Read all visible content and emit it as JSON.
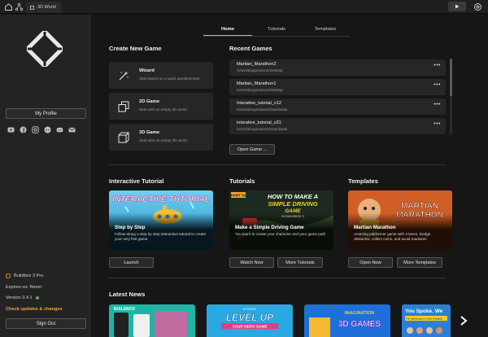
{
  "topbar": {
    "tab_title": "3D World"
  },
  "sidebar": {
    "profile_label": "My Profile",
    "socials": [
      "youtube-icon",
      "facebook-icon",
      "instagram-icon",
      "reddit-icon",
      "discord-icon",
      "mail-icon"
    ],
    "product": "Buildbox 3 Pro",
    "expires": "Expires on: Never",
    "version": "Version 3.4.1",
    "check_updates": "Check updates & changes",
    "signout_label": "Sign Out",
    "status_color": "#4caf50"
  },
  "nav": {
    "tabs": [
      "Home",
      "Tutorials",
      "Templates"
    ],
    "active": 0
  },
  "create": {
    "heading": "Create New Game",
    "items": [
      {
        "title": "Wizard",
        "subtitle": "Start based on a quick questionnaire",
        "icon": "wand-icon"
      },
      {
        "title": "2D Game",
        "subtitle": "Start with an empty 2D world",
        "icon": "2d-squares-icon"
      },
      {
        "title": "3D Game",
        "subtitle": "Start with an empty 3D world",
        "icon": "3d-cube-icon"
      }
    ]
  },
  "recent": {
    "heading": "Recent Games",
    "items": [
      {
        "name": "Martian_Marathon2",
        "path": "/Users/dougmanson/Desktop"
      },
      {
        "name": "Martian_Marathon1",
        "path": "/Users/dougmanson/Desktop"
      },
      {
        "name": "Interative_tutorial_v12",
        "path": "/Users/dougmanson/Downloads"
      },
      {
        "name": "interative_tutorial_v31",
        "path": "/Users/dougmanson/Downloads"
      }
    ],
    "more_label": "•••",
    "open_label": "Open Game ..."
  },
  "interactive": {
    "heading": "Interactive Tutorial",
    "card_title": "Step by Step",
    "card_desc": "Follow along a step by step interactive tutorial to create your very first game.",
    "banner_text": "INTERACTIVE TUTORIAL",
    "button": "Launch"
  },
  "tutorials": {
    "heading": "Tutorials",
    "card_title": "Make a Simple Driving Game",
    "card_desc": "You learn to create your character and your game path",
    "banner_line1": "HOW TO MAKE A",
    "banner_line2": "SIMPLE DRIVING",
    "banner_line3": "GAME",
    "banner_sub": "IN BUILDBOX 3",
    "banner_tag": "PART 01",
    "button_watch": "Watch Now",
    "button_more": "More Tutorials"
  },
  "templates": {
    "heading": "Templates",
    "card_title": "Martian Marathon",
    "card_desc": "Amazing platformer game with 3 lanes. Dodge obstacles, collect coins, and avoid martians!",
    "banner_line1": "MARTIAN",
    "banner_line2": "MARATHON",
    "button_open": "Open Now",
    "button_more": "More Templates"
  },
  "news": {
    "heading": "Latest News",
    "items": [
      {
        "label": "BUILDBOX",
        "color": "#1fb5a6"
      },
      {
        "label": "LEVEL UP",
        "sub": "YOUR VIDEO GAME",
        "top": "6 STEPS",
        "color": "#2aa8e0"
      },
      {
        "label": "3D GAMES",
        "top": "IMAGINATION",
        "color": "#1e6fd9"
      },
      {
        "label": "You Spoke. We",
        "sub": "The Marketplace Is Now Available",
        "color": "#2b7fd8"
      }
    ]
  },
  "colors": {
    "accent": "#f5a623",
    "bg": "#161616",
    "sidebar": "#232323",
    "card": "#262626"
  }
}
